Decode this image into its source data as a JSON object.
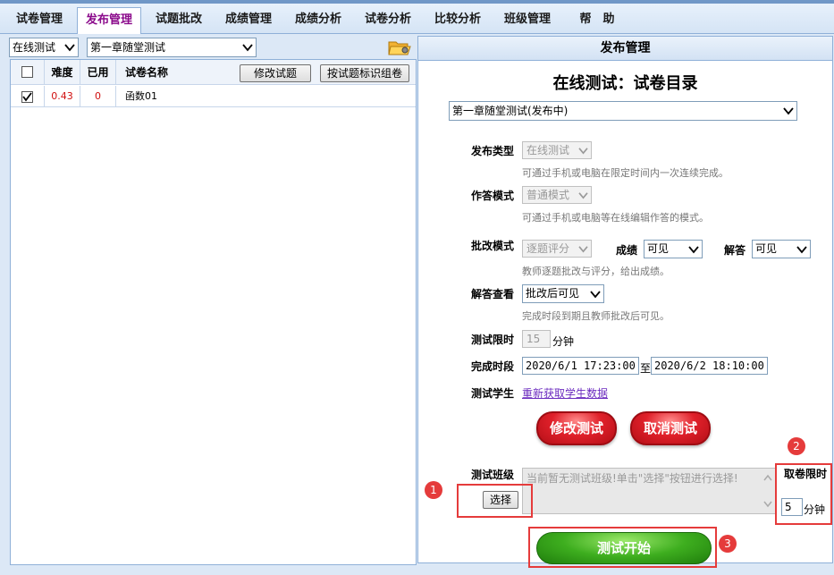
{
  "tabs": [
    {
      "label": "试卷管理",
      "active": false
    },
    {
      "label": "发布管理",
      "active": true
    },
    {
      "label": "试题批改",
      "active": false
    },
    {
      "label": "成绩管理",
      "active": false
    },
    {
      "label": "成绩分析",
      "active": false
    },
    {
      "label": "试卷分析",
      "active": false
    },
    {
      "label": "比较分析",
      "active": false
    },
    {
      "label": "班级管理",
      "active": false
    },
    {
      "label": "帮　助",
      "active": false
    }
  ],
  "left": {
    "type_select": "在线测试",
    "chapter_select": "第一章随堂测试",
    "headers": {
      "difficulty": "难度",
      "used": "已用",
      "name": "试卷名称"
    },
    "edit_button": "修改试题",
    "compose_button": "按试题标识组卷",
    "rows": [
      {
        "checked": true,
        "difficulty": "0.43",
        "used": "0",
        "name": "函数01"
      }
    ]
  },
  "right": {
    "panel_title": "发布管理",
    "heading": "在线测试：试卷目录",
    "paper_select": "第一章随堂测试(发布中)",
    "publish_type": {
      "label": "发布类型",
      "value": "在线测试",
      "hint": "可通过手机或电脑在限定时间内一次连续完成。"
    },
    "answer_mode": {
      "label": "作答模式",
      "value": "普通模式",
      "hint": "可通过手机或电脑等在线编辑作答的模式。"
    },
    "grading_mode": {
      "label": "批改模式",
      "value": "逐题评分",
      "hint": "教师逐题批改与评分，给出成绩。",
      "score_label": "成绩",
      "score_value": "可见",
      "answer_label": "解答",
      "answer_value": "可见"
    },
    "answer_view": {
      "label": "解答查看",
      "value": "批改后可见",
      "hint": "完成时段到期且教师批改后可见。"
    },
    "time_limit": {
      "label": "测试限时",
      "value": "15",
      "unit": "分钟"
    },
    "period": {
      "label": "完成时段",
      "start": "2020/6/1 17:23:00",
      "sep": "至",
      "end": "2020/6/2 18:10:00"
    },
    "students": {
      "label": "测试学生",
      "link": "重新获取学生数据"
    },
    "modify_button": "修改测试",
    "cancel_button": "取消测试",
    "class": {
      "label": "测试班级",
      "select_button": "选择",
      "placeholder": "当前暂无测试班级!单击\"选择\"按钮进行选择!"
    },
    "fetch": {
      "label": "取卷限时",
      "value": "5",
      "unit": "分钟"
    },
    "start_button": "测试开始"
  },
  "annotations": [
    "1",
    "2",
    "3"
  ],
  "colors": {
    "accent_red": "#e53b3b",
    "active_tab": "#8b0a8b",
    "link": "#6b2bbf",
    "difficulty_text": "#d01010"
  }
}
